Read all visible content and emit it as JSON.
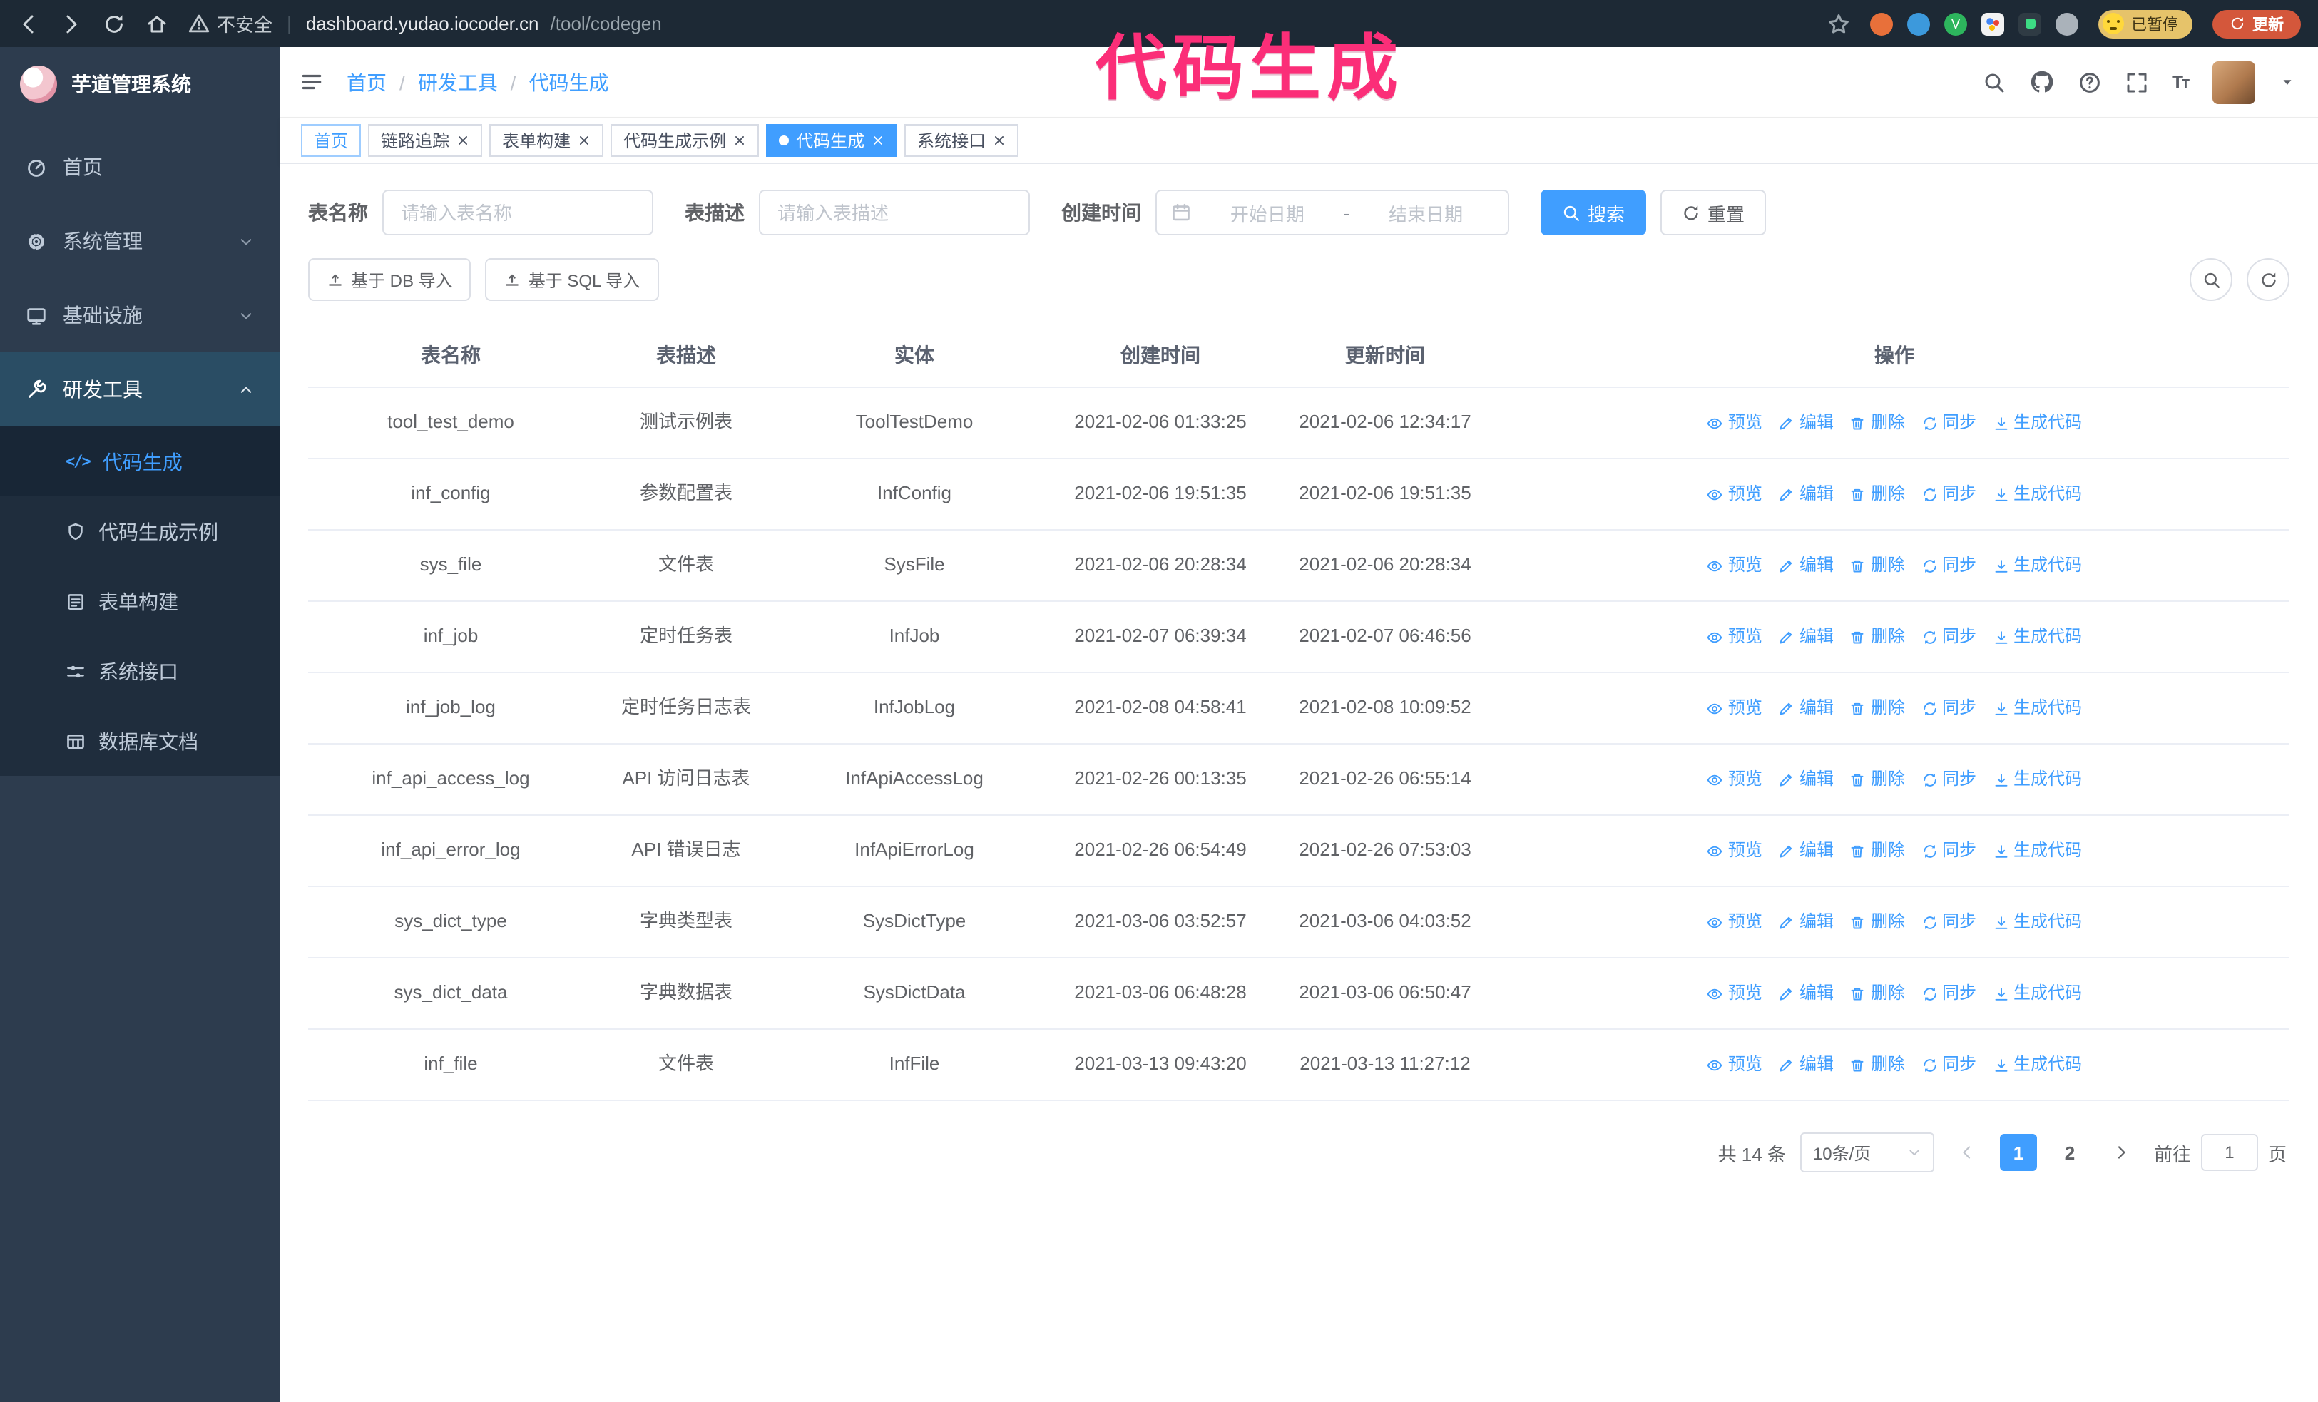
{
  "annotation": {
    "text": "代码生成"
  },
  "browser": {
    "security_label": "不安全",
    "url_host": "dashboard.yudao.iocoder.cn",
    "url_path": "/tool/codegen",
    "paused_badge": "已暂停",
    "update_button": "更新"
  },
  "sidebar": {
    "logo_title": "芋道管理系统",
    "items": [
      {
        "label": "首页"
      },
      {
        "label": "系统管理"
      },
      {
        "label": "基础设施"
      },
      {
        "label": "研发工具"
      }
    ],
    "submenu": [
      {
        "label": "代码生成"
      },
      {
        "label": "代码生成示例"
      },
      {
        "label": "表单构建"
      },
      {
        "label": "系统接口"
      },
      {
        "label": "数据库文档"
      }
    ]
  },
  "header": {
    "breadcrumb": [
      "首页",
      "研发工具",
      "代码生成"
    ],
    "breadcrumb_separator": "/"
  },
  "tabs": [
    {
      "label": "首页",
      "affix": true,
      "closable": false,
      "active": false
    },
    {
      "label": "链路追踪",
      "closable": true,
      "active": false
    },
    {
      "label": "表单构建",
      "closable": true,
      "active": false
    },
    {
      "label": "代码生成示例",
      "closable": true,
      "active": false
    },
    {
      "label": "代码生成",
      "closable": true,
      "active": true
    },
    {
      "label": "系统接口",
      "closable": true,
      "active": false
    }
  ],
  "filters": {
    "name_label": "表名称",
    "name_placeholder": "请输入表名称",
    "desc_label": "表描述",
    "desc_placeholder": "请输入表描述",
    "time_label": "创建时间",
    "start_placeholder": "开始日期",
    "range_separator": "-",
    "end_placeholder": "结束日期",
    "search_button": "搜索",
    "reset_button": "重置"
  },
  "toolbar": {
    "import_db": "基于 DB 导入",
    "import_sql": "基于 SQL 导入"
  },
  "table": {
    "columns": [
      "表名称",
      "表描述",
      "实体",
      "创建时间",
      "更新时间",
      "操作"
    ],
    "actions": [
      "预览",
      "编辑",
      "删除",
      "同步",
      "生成代码"
    ],
    "rows": [
      {
        "name": "tool_test_demo",
        "desc": "测试示例表",
        "entity": "ToolTestDemo",
        "created": "2021-02-06 01:33:25",
        "updated": "2021-02-06 12:34:17"
      },
      {
        "name": "inf_config",
        "desc": "参数配置表",
        "entity": "InfConfig",
        "created": "2021-02-06 19:51:35",
        "updated": "2021-02-06 19:51:35"
      },
      {
        "name": "sys_file",
        "desc": "文件表",
        "entity": "SysFile",
        "created": "2021-02-06 20:28:34",
        "updated": "2021-02-06 20:28:34"
      },
      {
        "name": "inf_job",
        "desc": "定时任务表",
        "entity": "InfJob",
        "created": "2021-02-07 06:39:34",
        "updated": "2021-02-07 06:46:56"
      },
      {
        "name": "inf_job_log",
        "desc": "定时任务日志表",
        "entity": "InfJobLog",
        "created": "2021-02-08 04:58:41",
        "updated": "2021-02-08 10:09:52"
      },
      {
        "name": "inf_api_access_log",
        "desc": "API 访问日志表",
        "entity": "InfApiAccessLog",
        "created": "2021-02-26 00:13:35",
        "updated": "2021-02-26 06:55:14"
      },
      {
        "name": "inf_api_error_log",
        "desc": "API 错误日志",
        "entity": "InfApiErrorLog",
        "created": "2021-02-26 06:54:49",
        "updated": "2021-02-26 07:53:03"
      },
      {
        "name": "sys_dict_type",
        "desc": "字典类型表",
        "entity": "SysDictType",
        "created": "2021-03-06 03:52:57",
        "updated": "2021-03-06 04:03:52"
      },
      {
        "name": "sys_dict_data",
        "desc": "字典数据表",
        "entity": "SysDictData",
        "created": "2021-03-06 06:48:28",
        "updated": "2021-03-06 06:50:47"
      },
      {
        "name": "inf_file",
        "desc": "文件表",
        "entity": "InfFile",
        "created": "2021-03-13 09:43:20",
        "updated": "2021-03-13 11:27:12"
      }
    ]
  },
  "pagination": {
    "total": "共 14 条",
    "page_size": "10条/页",
    "pages": [
      "1",
      "2"
    ],
    "current": "1",
    "goto_prefix": "前往",
    "goto_value": "1",
    "goto_suffix": "页"
  },
  "icons": {
    "code_glyph": "</>"
  },
  "colors": {
    "primary": "#409eff",
    "sidebar_bg": "#2d3c4e",
    "submenu_bg": "#1f2d3d",
    "annotation": "#fb2e78",
    "chrome_bg": "#1d2935"
  }
}
